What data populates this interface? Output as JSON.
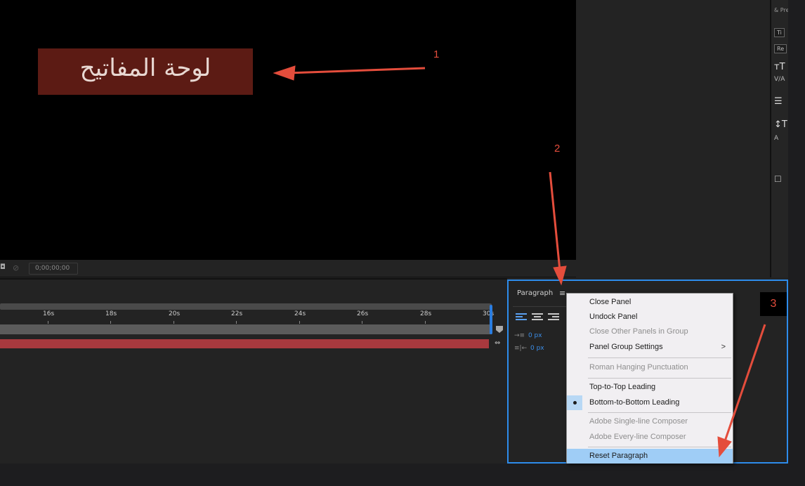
{
  "viewer": {
    "arabic_text": "لوحة المفاتيح",
    "timecode": "0;00;00;00"
  },
  "character_panel": {
    "tab_label": "& Pre",
    "field1": "Ti",
    "field2": "Re",
    "icons": [
      "font-size-icon",
      "kerning-icon",
      "align-icon",
      "vertical-scale-icon",
      "baseline-shift-icon",
      "checkbox-icon"
    ]
  },
  "timeline": {
    "ruler_labels": [
      "16s",
      "18s",
      "20s",
      "22s",
      "24s",
      "26s",
      "28s",
      "30s"
    ]
  },
  "paragraph_panel": {
    "title": "Paragraph",
    "indent_left": "0 px",
    "indent_right": "0 px"
  },
  "menu": {
    "close_panel": "Close Panel",
    "undock_panel": "Undock Panel",
    "close_other_panels": "Close Other Panels in Group",
    "panel_group_settings": "Panel Group Settings",
    "roman_hanging_punctuation": "Roman Hanging Punctuation",
    "top_to_top_leading": "Top-to-Top Leading",
    "bottom_to_bottom_leading": "Bottom-to-Bottom Leading",
    "adobe_single_line_composer": "Adobe Single-line Composer",
    "adobe_every_line_composer": "Adobe Every-line Composer",
    "reset_paragraph": "Reset Paragraph",
    "submenu_arrow": ">"
  },
  "annotations": {
    "n1": "1",
    "n2": "2",
    "n3": "3",
    "color": "#e44d3c"
  }
}
